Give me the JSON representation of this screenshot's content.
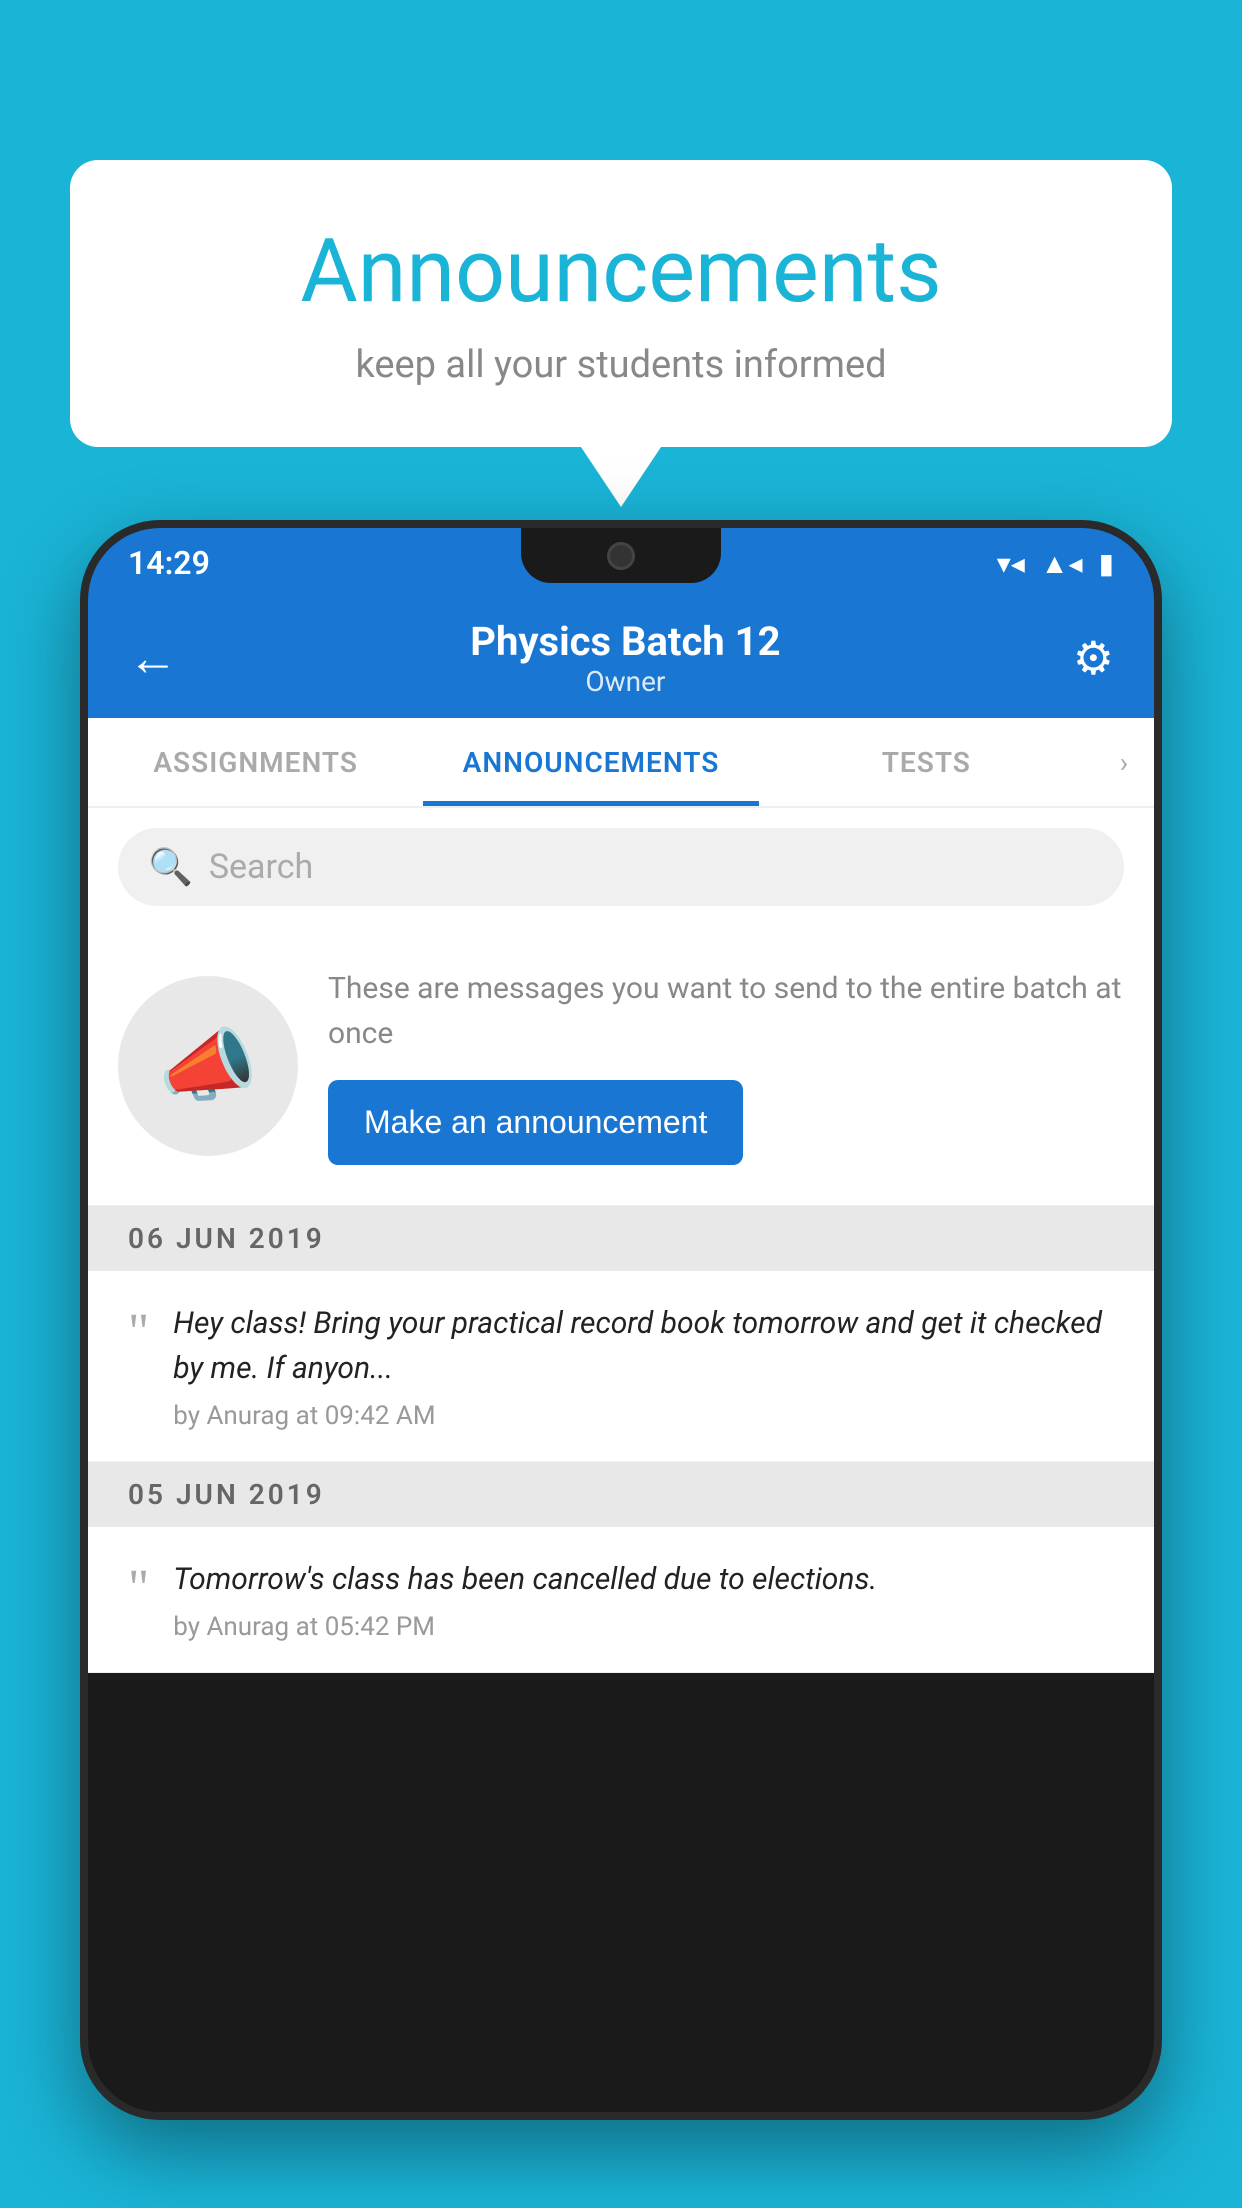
{
  "background_color": "#1ab4d7",
  "speech_bubble": {
    "title": "Announcements",
    "subtitle": "keep all your students informed"
  },
  "phone": {
    "status_bar": {
      "time": "14:29",
      "wifi_icon": "wifi",
      "signal_icon": "signal",
      "battery_icon": "battery"
    },
    "app_bar": {
      "back_label": "←",
      "title": "Physics Batch 12",
      "subtitle": "Owner",
      "settings_icon": "⚙"
    },
    "tabs": [
      {
        "label": "ASSIGNMENTS",
        "active": false
      },
      {
        "label": "ANNOUNCEMENTS",
        "active": true
      },
      {
        "label": "TESTS",
        "active": false
      }
    ],
    "search": {
      "placeholder": "Search"
    },
    "promo": {
      "description": "These are messages you want to send to the entire batch at once",
      "button_label": "Make an announcement"
    },
    "announcements": [
      {
        "date": "06  JUN  2019",
        "text": "Hey class! Bring your practical record book tomorrow and get it checked by me. If anyon...",
        "by": "by Anurag at 09:42 AM"
      },
      {
        "date": "05  JUN  2019",
        "text": "Tomorrow's class has been cancelled due to elections.",
        "by": "by Anurag at 05:42 PM"
      }
    ]
  }
}
